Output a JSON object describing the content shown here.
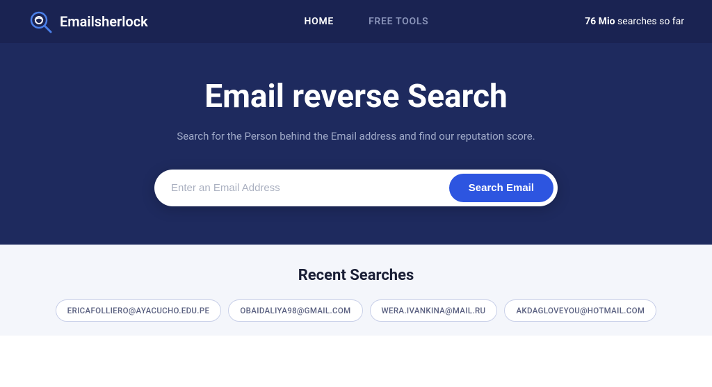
{
  "header": {
    "logo_text": "Emailsherlock",
    "nav": [
      {
        "label": "HOME",
        "active": true
      },
      {
        "label": "FREE TOOLS",
        "active": false
      }
    ],
    "search_count_bold": "76 Mio",
    "search_count_text": " searches so far"
  },
  "hero": {
    "title": "Email reverse Search",
    "subtitle": "Search for the Person behind the Email address and find our reputation score.",
    "input_placeholder": "Enter an Email Address",
    "button_label": "Search Email"
  },
  "recent": {
    "section_title": "Recent Searches",
    "items": [
      {
        "email": "ERICAFOLLIERO@AYACUCHO.EDU.PE"
      },
      {
        "email": "OBAIDALIYA98@GMAIL.COM"
      },
      {
        "email": "WERA.IVANKINA@MAIL.RU"
      },
      {
        "email": "AKDAGLOVEYOU@HOTMAIL.COM"
      }
    ]
  }
}
